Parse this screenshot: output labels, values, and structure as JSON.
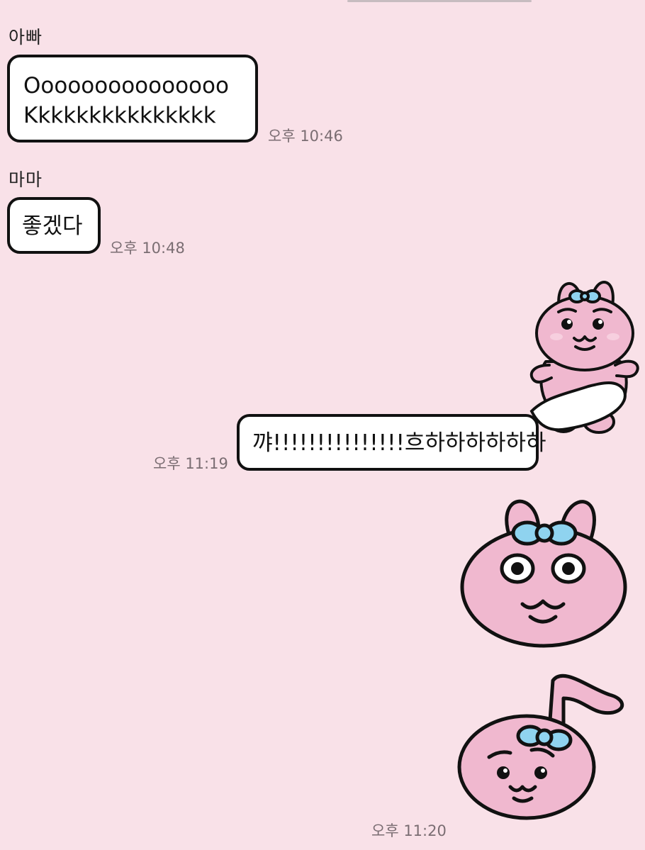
{
  "messages": [
    {
      "sender": "아빠",
      "lines": [
        "Ooooooooooooooo",
        "Kkkkkkkkkkkkkkk"
      ],
      "time": "오후 10:46"
    },
    {
      "sender": "마마",
      "lines": [
        "좋겠다"
      ],
      "time": "오후 10:48"
    },
    {
      "type": "outgoing",
      "text": "꺄!!!!!!!!!!!!!!!흐하하하하하하",
      "time": "오후 11:19",
      "sticker": "pink-bunny-waving-sticker"
    },
    {
      "type": "outgoing-stickers",
      "stickers": [
        "pink-bunny-surprised-face-sticker",
        "pink-bunny-music-note-sticker"
      ],
      "time": "오후 11:20"
    }
  ],
  "colors": {
    "background": "#f9e1e8",
    "bunny_pink": "#f0b8cf",
    "bow_blue": "#8fd3ef",
    "bubble": "#ffffff",
    "time_text": "#7a6d72"
  }
}
